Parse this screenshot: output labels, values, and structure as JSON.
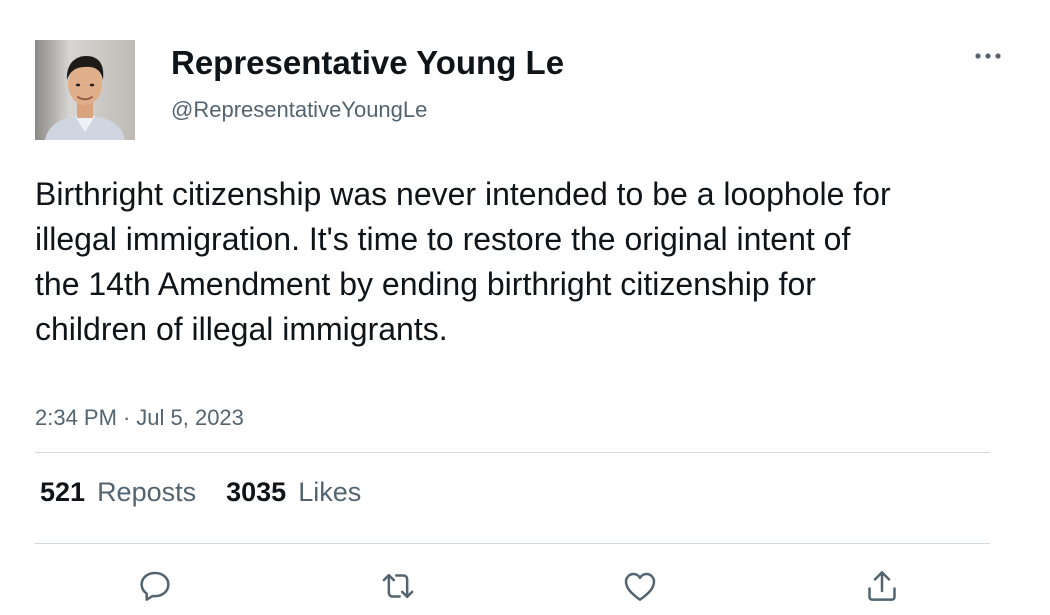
{
  "user": {
    "display_name": "Representative Young Le",
    "handle": "@RepresentativeYoungLe"
  },
  "tweet": {
    "text": "Birthright citizenship was never intended to be a loophole for illegal immigration. It's time to restore the original intent of the 14th Amendment by ending birthright citizenship for children of illegal immigrants.",
    "time": "2:34 PM",
    "separator": "·",
    "date": "Jul 5, 2023"
  },
  "stats": {
    "reposts_count": "521",
    "reposts_label": "Reposts",
    "likes_count": "3035",
    "likes_label": "Likes"
  },
  "icons": {
    "more": "more-horizontal-icon",
    "reply": "reply-icon",
    "repost": "repost-icon",
    "like": "heart-icon",
    "share": "share-icon"
  },
  "colors": {
    "text_primary": "#0f1419",
    "text_secondary": "#536471",
    "divider": "#cfd9de",
    "icon": "#536471"
  }
}
